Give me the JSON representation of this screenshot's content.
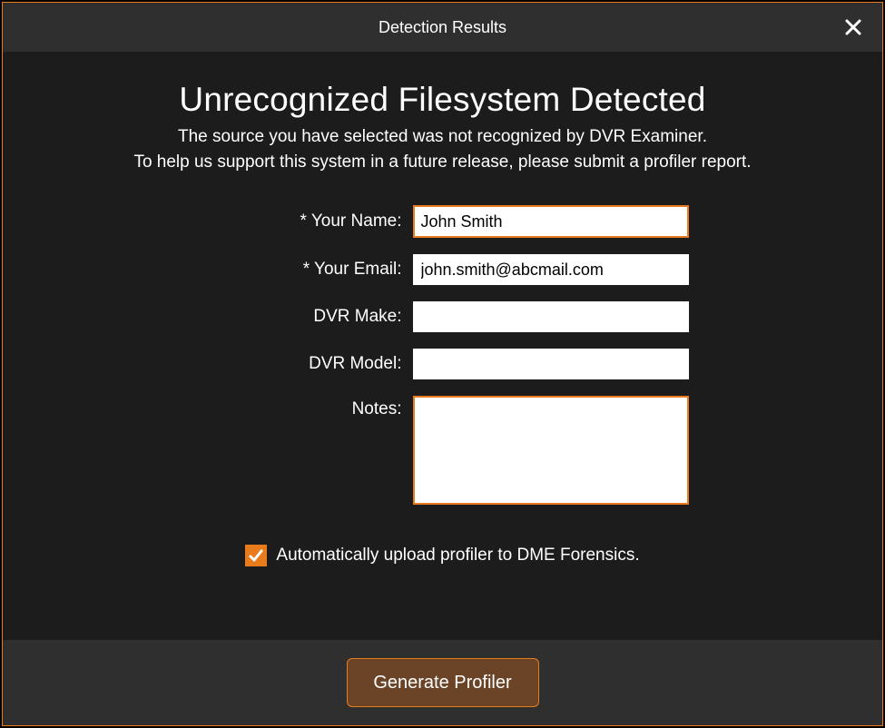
{
  "titlebar": {
    "title": "Detection Results"
  },
  "heading": "Unrecognized Filesystem Detected",
  "subtext_line1": "The source you have selected was not recognized by DVR Examiner.",
  "subtext_line2": "To help us support this system in a future release, please submit a profiler report.",
  "form": {
    "name_label": "* Your Name:",
    "name_value": "John Smith",
    "email_label": "* Your Email:",
    "email_value": "john.smith@abcmail.com",
    "make_label": "DVR Make:",
    "make_value": "",
    "model_label": "DVR Model:",
    "model_value": "",
    "notes_label": "Notes:",
    "notes_value": ""
  },
  "checkbox": {
    "checked": true,
    "label": "Automatically upload profiler to DME Forensics."
  },
  "footer": {
    "generate_label": "Generate Profiler"
  },
  "colors": {
    "accent": "#e87c1c",
    "panel": "#1c1c1c",
    "bar": "#2f2f2f",
    "button": "#6b4428"
  }
}
